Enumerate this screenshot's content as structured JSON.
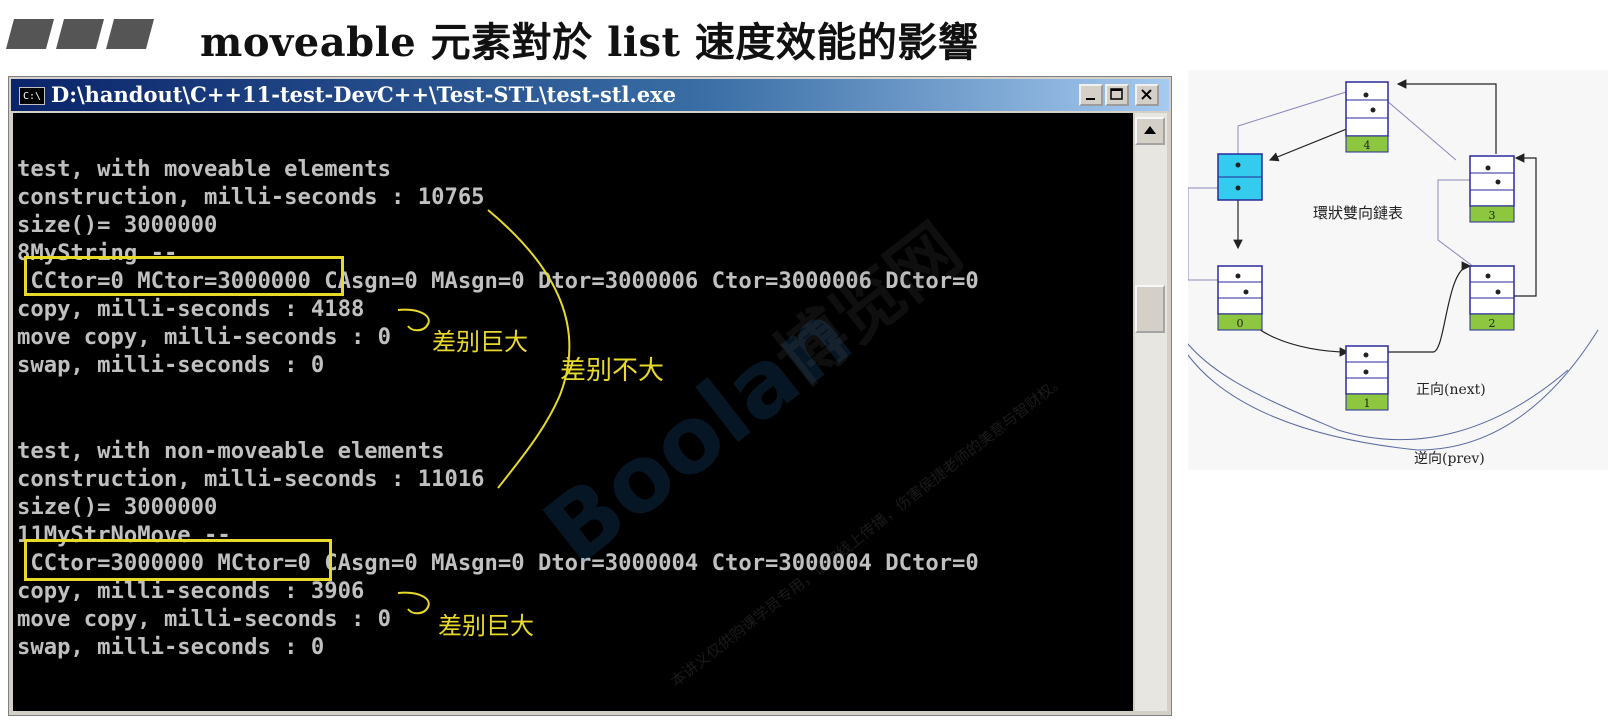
{
  "slide": {
    "title": "moveable 元素對於 list 速度效能的影響"
  },
  "window": {
    "title": "D:\\handout\\C++11-test-DevC++\\Test-STL\\test-stl.exe",
    "icon_label": "C:\\",
    "minimize": "_",
    "maximize": "□",
    "close": "×"
  },
  "console": {
    "lines": [
      "test, with moveable elements",
      "construction, milli-seconds : 10765",
      "size()= 3000000",
      "8MyString --",
      " CCtor=0 MCtor=3000000 CAsgn=0 MAsgn=0 Dtor=3000006 Ctor=3000006 DCtor=0",
      "copy, milli-seconds : 4188",
      "move copy, milli-seconds : 0",
      "swap, milli-seconds : 0",
      "",
      "",
      "test, with non-moveable elements",
      "construction, milli-seconds : 11016",
      "size()= 3000000",
      "11MyStrNoMove --",
      " CCtor=3000000 MCtor=0 CAsgn=0 MAsgn=0 Dtor=3000004 Ctor=3000004 DCtor=0",
      "copy, milli-seconds : 3906",
      "move copy, milli-seconds : 0",
      "swap, milli-seconds : 0"
    ]
  },
  "annotations": {
    "note_move_big": "差别巨大",
    "note_construction_small": "差别不大",
    "note_nomove_big": "差别巨大"
  },
  "diagram": {
    "title": "環狀雙向鏈表",
    "nodes": [
      "4",
      "3",
      "2",
      "1",
      "0"
    ],
    "forward_label": "正向(next)",
    "backward_label": "逆向(prev)"
  },
  "watermark": {
    "brand": "Boolan",
    "brand_cn": "博览网",
    "notice_1": "本讲义仅供购课学员专用，请勿线上传播，伤害侯捷老师的美意与智财权。"
  },
  "colors": {
    "highlight": "#e8d92a",
    "console_bg": "#000000",
    "console_text": "#c0c0c0",
    "node_green": "#8dc63f",
    "node_cyan": "#33ccee",
    "node_border": "#2a2a9a"
  }
}
